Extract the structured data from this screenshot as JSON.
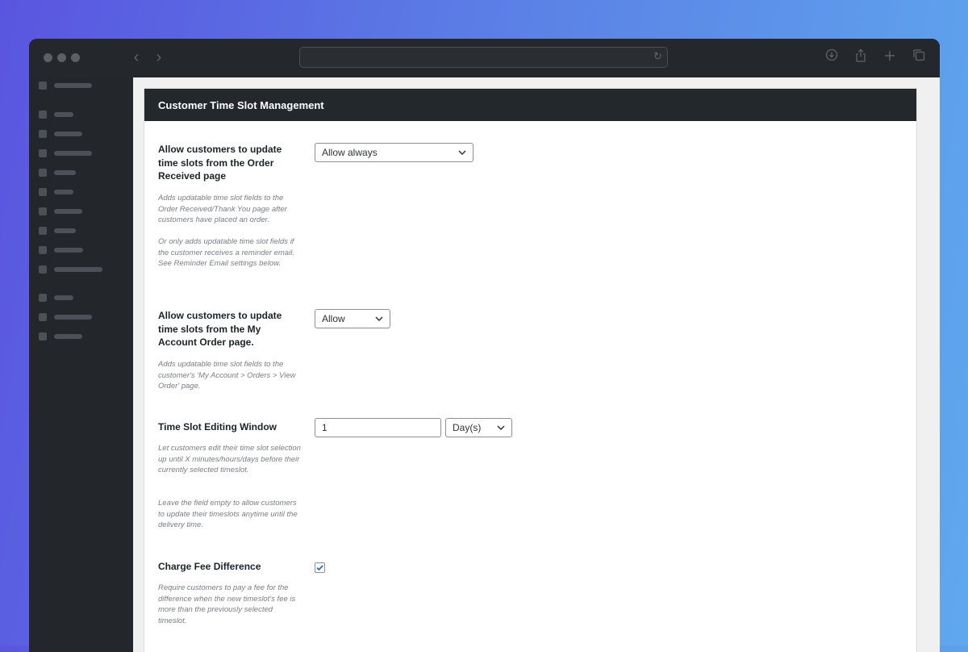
{
  "browser": {
    "icons": {
      "back": "chevron-left-icon",
      "forward": "chevron-right-icon",
      "reload": "reload-icon",
      "download": "download-icon",
      "share": "share-icon",
      "new_tab": "plus-icon",
      "tabs": "tabs-icon"
    }
  },
  "panel": {
    "title": "Customer Time Slot Management"
  },
  "settings": {
    "order_received": {
      "label": "Allow customers to update time slots from the Order Received page",
      "desc1": "Adds updatable time slot fields to the Order Received/Thank You page after customers have placed an order.",
      "desc2": "Or only adds updatable time slot fields if the customer receives a reminder email. See Reminder Email settings below.",
      "value": "Allow always"
    },
    "my_account": {
      "label": "Allow customers to update time slots from the My Account Order page.",
      "desc": "Adds updatable time slot fields to the customer's 'My Account > Orders > View Order' page.",
      "value": "Allow"
    },
    "editing_window": {
      "label": "Time Slot Editing Window",
      "desc1": "Let customers edit their time slot selection up until X minutes/hours/days before their currently selected timeslot.",
      "desc2": "Leave the field empty to allow customers to update their timeslots anytime until the delivery time.",
      "amount": "1",
      "unit": "Day(s)"
    },
    "charge_fee": {
      "label": "Charge Fee Difference",
      "desc": "Require customers to pay a fee for the difference when the new timeslot's fee is more than the previously selected timeslot.",
      "checked": true
    }
  },
  "colors": {
    "header_bg": "#23282d",
    "accent": "#2271b1",
    "sidebar_bg": "#23262b"
  }
}
